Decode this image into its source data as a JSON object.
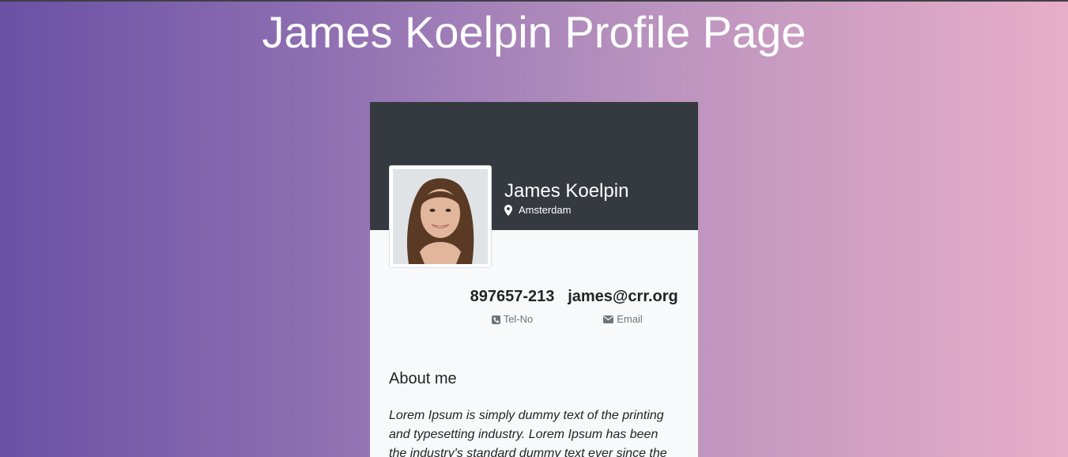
{
  "page": {
    "title": "James Koelpin Profile Page"
  },
  "profile": {
    "name": "James Koelpin",
    "location": "Amsterdam",
    "avatar_icon": "person-photo"
  },
  "stats": {
    "phone": {
      "value": "897657-213",
      "label": "Tel-No",
      "icon": "phone-icon"
    },
    "email": {
      "value": "james@crr.org",
      "label": "Email",
      "icon": "envelope-icon"
    }
  },
  "about": {
    "title": "About me",
    "text": "Lorem Ipsum is simply dummy text of the printing and typesetting industry. Lorem Ipsum has been the industry's standard dummy text ever since the"
  },
  "colors": {
    "gradient_start": "#6a51a4",
    "gradient_end": "#e9aec8",
    "card_header": "#343a40",
    "card_body": "#f8f9fa"
  }
}
